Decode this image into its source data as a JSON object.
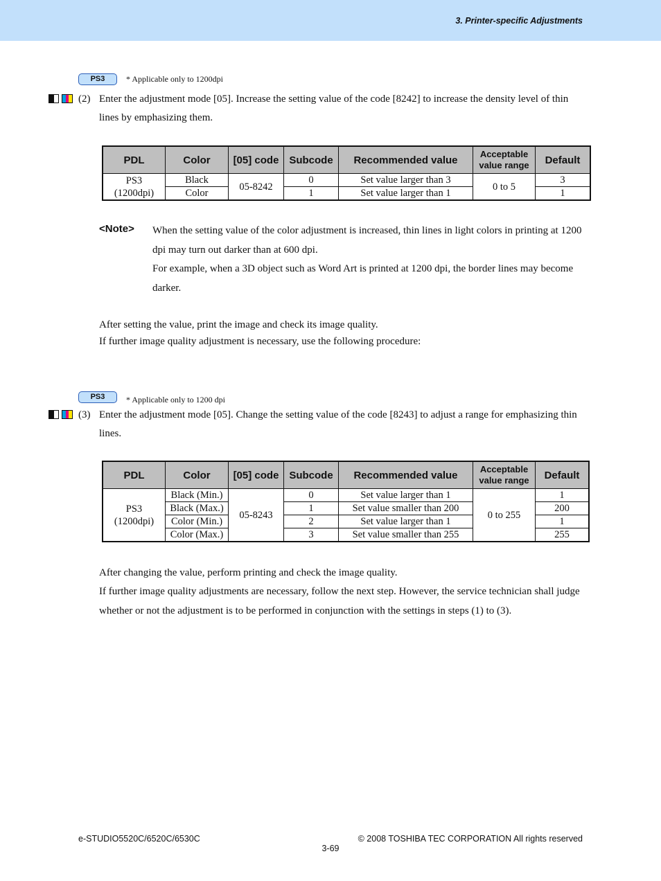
{
  "header": {
    "section_title": "3. Printer-specific Adjustments",
    "band_color": "#c2e0fb"
  },
  "section2": {
    "badge": "PS3",
    "badge_note": "* Applicable only to 1200dpi",
    "icons": [
      "black-white-icon",
      "color-cmy-icon"
    ],
    "step_number": "(2)",
    "step_text": "Enter the adjustment mode [05]. Increase the setting value of the code [8242] to increase the density level of thin lines by emphasizing them.",
    "table": {
      "headers": [
        "PDL",
        "Color",
        "[05] code",
        "Subcode",
        "Recommended value",
        "Acceptable value range",
        "Default"
      ],
      "pdl": "PS3\n(1200dpi)",
      "pdl_line1": "PS3",
      "pdl_line2": "(1200dpi)",
      "code": "05-8242",
      "range": "0 to 5",
      "rows": [
        {
          "color": "Black",
          "subcode": "0",
          "recommended": "Set value larger than 3",
          "default": "3"
        },
        {
          "color": "Color",
          "subcode": "1",
          "recommended": "Set value larger than 1",
          "default": "1"
        }
      ]
    },
    "note": {
      "label": "<Note>",
      "lines": [
        "When the setting value of the color adjustment is increased, thin lines in light colors in printing at 1200 dpi may turn out darker than at 600 dpi.",
        "For example, when a 3D object such as Word Art is printed at 1200 dpi, the border lines may become darker."
      ]
    },
    "after": [
      "After setting the value, print the image and check its image quality.",
      "If further image quality adjustment is necessary, use the following procedure:"
    ]
  },
  "section3": {
    "badge": "PS3",
    "badge_note": "* Applicable only to 1200 dpi",
    "step_number": "(3)",
    "step_text": "Enter the adjustment mode [05]. Change the setting value of the code [8243] to adjust a range for emphasizing thin lines.",
    "table": {
      "headers": [
        "PDL",
        "Color",
        "[05] code",
        "Subcode",
        "Recommended value",
        "Acceptable value range",
        "Default"
      ],
      "pdl_line1": "PS3",
      "pdl_line2": "(1200dpi)",
      "code": "05-8243",
      "range": "0 to 255",
      "rows": [
        {
          "color": "Black (Min.)",
          "subcode": "0",
          "recommended": "Set value larger than 1",
          "default": "1"
        },
        {
          "color": "Black (Max.)",
          "subcode": "1",
          "recommended": "Set value smaller than 200",
          "default": "200"
        },
        {
          "color": "Color (Min.)",
          "subcode": "2",
          "recommended": "Set value larger than 1",
          "default": "1"
        },
        {
          "color": "Color (Max.)",
          "subcode": "3",
          "recommended": "Set value smaller than 255",
          "default": "255"
        }
      ]
    },
    "after": [
      "After changing the value, perform printing and check the image quality.",
      "If further image quality adjustments are necessary, follow the next step. However, the service technician shall judge whether or not the adjustment is to be performed in conjunction with the settings in steps (1) to (3)."
    ]
  },
  "footer": {
    "model": "e-STUDIO5520C/6520C/6530C",
    "copyright": "© 2008 TOSHIBA TEC CORPORATION All rights reserved",
    "page": "3-69"
  }
}
